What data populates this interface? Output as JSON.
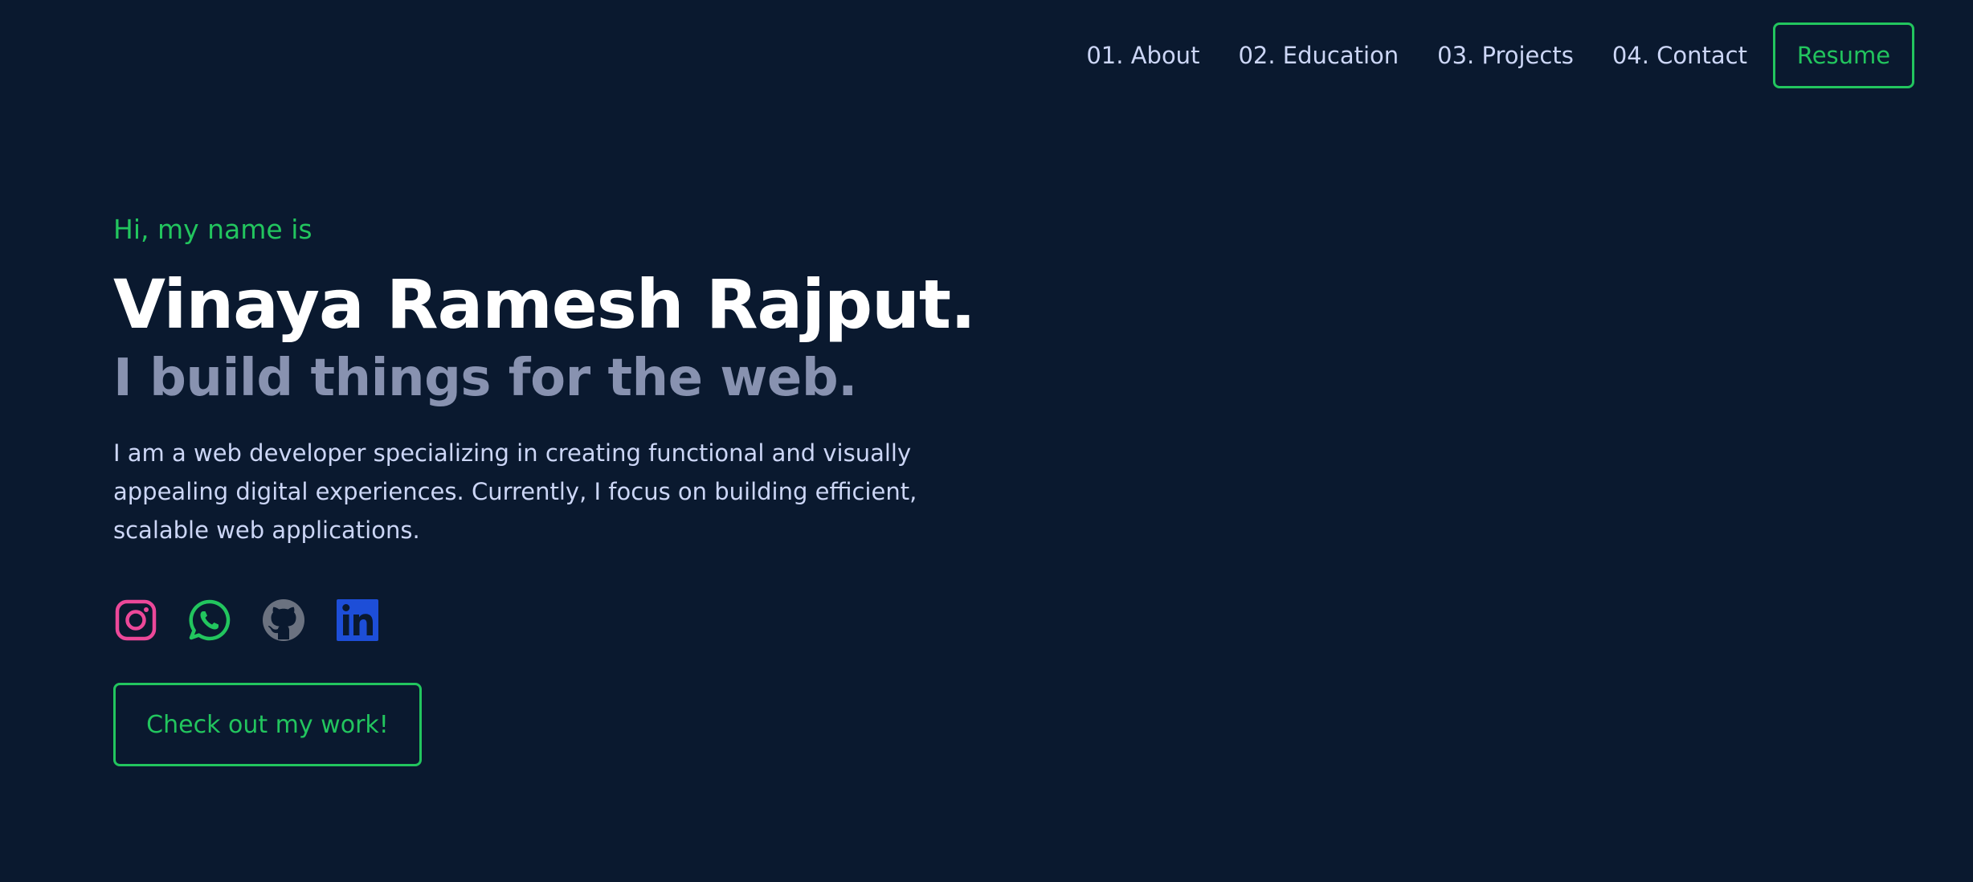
{
  "nav": {
    "items": [
      {
        "label": "01. About"
      },
      {
        "label": "02. Education"
      },
      {
        "label": "03. Projects"
      },
      {
        "label": "04. Contact"
      }
    ],
    "resume_label": "Resume"
  },
  "hero": {
    "greeting": "Hi, my name is",
    "name": "Vinaya Ramesh Rajput.",
    "tagline": "I build things for the web.",
    "bio": "I am a web developer specializing in creating functional and visually appealing digital experiences. Currently, I focus on building efficient, scalable web applications.",
    "cta_label": "Check out my work!"
  },
  "socials": [
    {
      "icon": "instagram-icon",
      "color": "#ec4899"
    },
    {
      "icon": "whatsapp-icon",
      "color": "#22c55e"
    },
    {
      "icon": "github-icon",
      "color": "#6b7280"
    },
    {
      "icon": "linkedin-icon",
      "color": "#1d4ed8"
    }
  ],
  "colors": {
    "background": "#0a192f",
    "accent": "#22c55e",
    "heading": "#ffffff",
    "muted": "#8892b0",
    "text": "#ccd6f6"
  }
}
